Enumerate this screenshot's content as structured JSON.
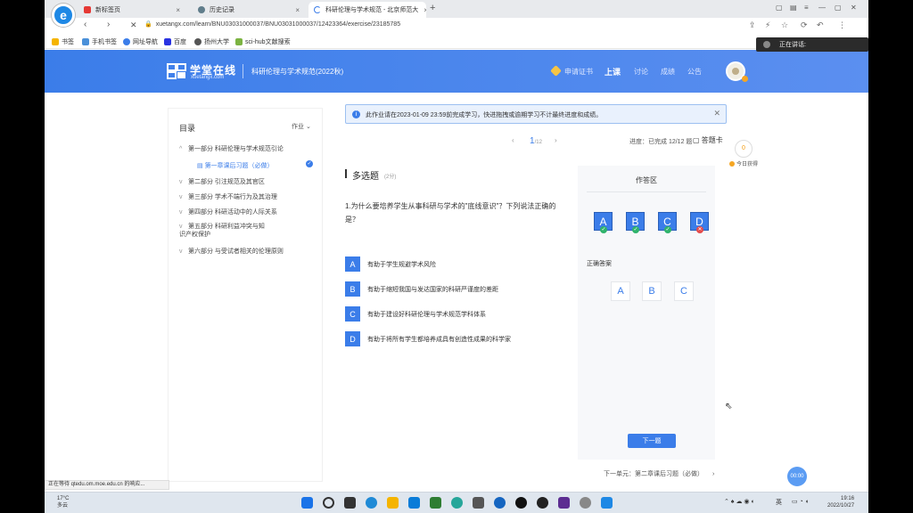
{
  "browser": {
    "logo": "e",
    "tabs": [
      {
        "label": "新标签页",
        "color": "#e53935"
      },
      {
        "label": "历史记录",
        "color": "#607d8b"
      },
      {
        "label": "科研伦理与学术规范 - 北京师范大",
        "color": "#3b7de9"
      }
    ],
    "new_tab": "+",
    "url": "xuetangx.com/learn/BNU03031000037/BNU03031000037/12423364/exercise/23185785",
    "toast": "正在讲话:",
    "bookmarks": [
      {
        "label": "书签",
        "color": "#f5b400"
      },
      {
        "label": "手机书签",
        "color": "#4a90d9"
      },
      {
        "label": "网址导航",
        "color": "#3b7de9"
      },
      {
        "label": "百度",
        "color": "#2932e1"
      },
      {
        "label": "扬州大学",
        "color": "#555555"
      },
      {
        "label": "sci-hub文献搜索",
        "color": "#7cb342"
      }
    ]
  },
  "site": {
    "logo_title": "学堂在线",
    "logo_sub": "xuetangx.com",
    "course_title": "科研伦理与学术规范(2022秋)",
    "nav": {
      "cert": "申请证书",
      "class": "上课",
      "discuss": "讨论",
      "score": "成绩",
      "announce": "公告"
    }
  },
  "sidebar": {
    "title": "目录",
    "filter": "作业",
    "items": [
      {
        "label": "第一部分 科研伦理与学术规范引论",
        "chev": "^"
      },
      {
        "label": "第二部分 引注规范及其官区",
        "chev": "v"
      },
      {
        "label": "第三部分 学术不端行为及其治理",
        "chev": "v"
      },
      {
        "label": "第四部分 科研活动中的人际关系",
        "chev": "v"
      },
      {
        "label": "第五部分 科研利益冲突与知识产权保护",
        "chev": "v"
      },
      {
        "label": "第六部分 与受试者相关的伦理原则",
        "chev": "v"
      }
    ],
    "active_sub": "第一章课后习题（必做）"
  },
  "notice": {
    "text": "此作业请在2023-01-09 23:59前完成学习，快进拖拽或逾期学习不计最终进度和成绩。"
  },
  "pager": {
    "current": "1",
    "total": "/12",
    "progress": "进度：已完成 12/12 题",
    "card": "答题卡",
    "score": "0",
    "today": "今日获得"
  },
  "question": {
    "type": "多选题",
    "points": "(2分)",
    "text": "1.为什么要培养学生从事科研与学术的\"底线意识\"？下列说法正确的是？",
    "options": [
      {
        "key": "A",
        "label": "有助于学生规避学术风险"
      },
      {
        "key": "B",
        "label": "有助于缩短我国与发达国家的科研严谨度的差距"
      },
      {
        "key": "C",
        "label": "有助于建设好科研伦理与学术规范学科体系"
      },
      {
        "key": "D",
        "label": "有助于将所有学生都培养成具有创造性成果的科学家"
      }
    ]
  },
  "answer_panel": {
    "title": "作答区",
    "chosen": [
      {
        "key": "A",
        "status": "correct"
      },
      {
        "key": "B",
        "status": "correct"
      },
      {
        "key": "C",
        "status": "correct"
      },
      {
        "key": "D",
        "status": "wrong"
      }
    ],
    "correct_label": "正确答案",
    "correct": [
      "A",
      "B",
      "C"
    ],
    "next_button": "下一题",
    "status_colors": {
      "correct": "#2fb36b",
      "wrong": "#e54b4b"
    }
  },
  "footer": {
    "next_unit": "下一单元：第二章课后习题（必做）",
    "timer": "00:00",
    "status": "正在等待 qtedu.om.moe.edu.cn 的响应..."
  },
  "taskbar": {
    "temp": "17°C",
    "weather": "多云",
    "time": "19:16",
    "date": "2022/10/27",
    "lang": "英"
  }
}
